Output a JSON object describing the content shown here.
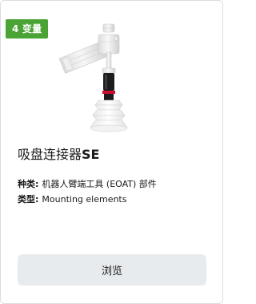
{
  "badge": {
    "text": "4 变量",
    "color": "#4aa335"
  },
  "product": {
    "image_icon": "suction-cup-connector-image",
    "title_main": "吸盘连接器",
    "title_suffix": "SE",
    "category_label": "种类:",
    "category_value": "机器人臂端工具 (EOAT) 部件",
    "type_label": "类型:",
    "type_value": "Mounting elements"
  },
  "actions": {
    "browse_label": "浏览"
  }
}
